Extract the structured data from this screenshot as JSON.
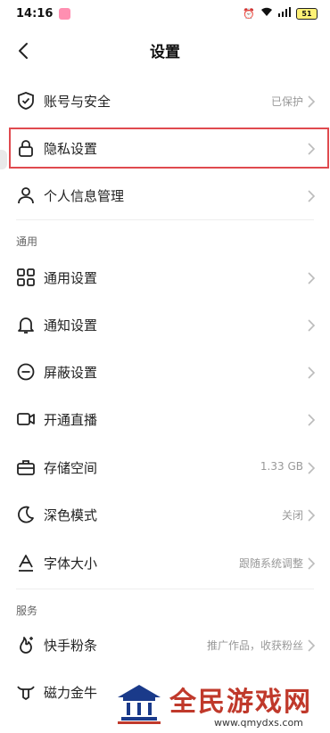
{
  "status_bar": {
    "time": "14:16",
    "battery": "51"
  },
  "header": {
    "title": "设置"
  },
  "account_section": [
    {
      "label": "账号与安全",
      "value": "已保护"
    },
    {
      "label": "隐私设置",
      "value": ""
    },
    {
      "label": "个人信息管理",
      "value": ""
    }
  ],
  "general_section": {
    "title": "通用",
    "items": [
      {
        "label": "通用设置",
        "value": ""
      },
      {
        "label": "通知设置",
        "value": ""
      },
      {
        "label": "屏蔽设置",
        "value": ""
      },
      {
        "label": "开通直播",
        "value": ""
      },
      {
        "label": "存储空间",
        "value": "1.33 GB"
      },
      {
        "label": "深色模式",
        "value": "关闭"
      },
      {
        "label": "字体大小",
        "value": "跟随系统调整"
      }
    ]
  },
  "service_section": {
    "title": "服务",
    "items": [
      {
        "label": "快手粉条",
        "value": "推广作品，收获粉丝"
      },
      {
        "label": "磁力金牛",
        "value": ""
      }
    ]
  },
  "watermark": {
    "text": "全民游戏网",
    "url": "www.qmydxs.com"
  },
  "colors": {
    "highlight": "#e04a4f",
    "text": "#222222",
    "secondary": "#999999"
  }
}
